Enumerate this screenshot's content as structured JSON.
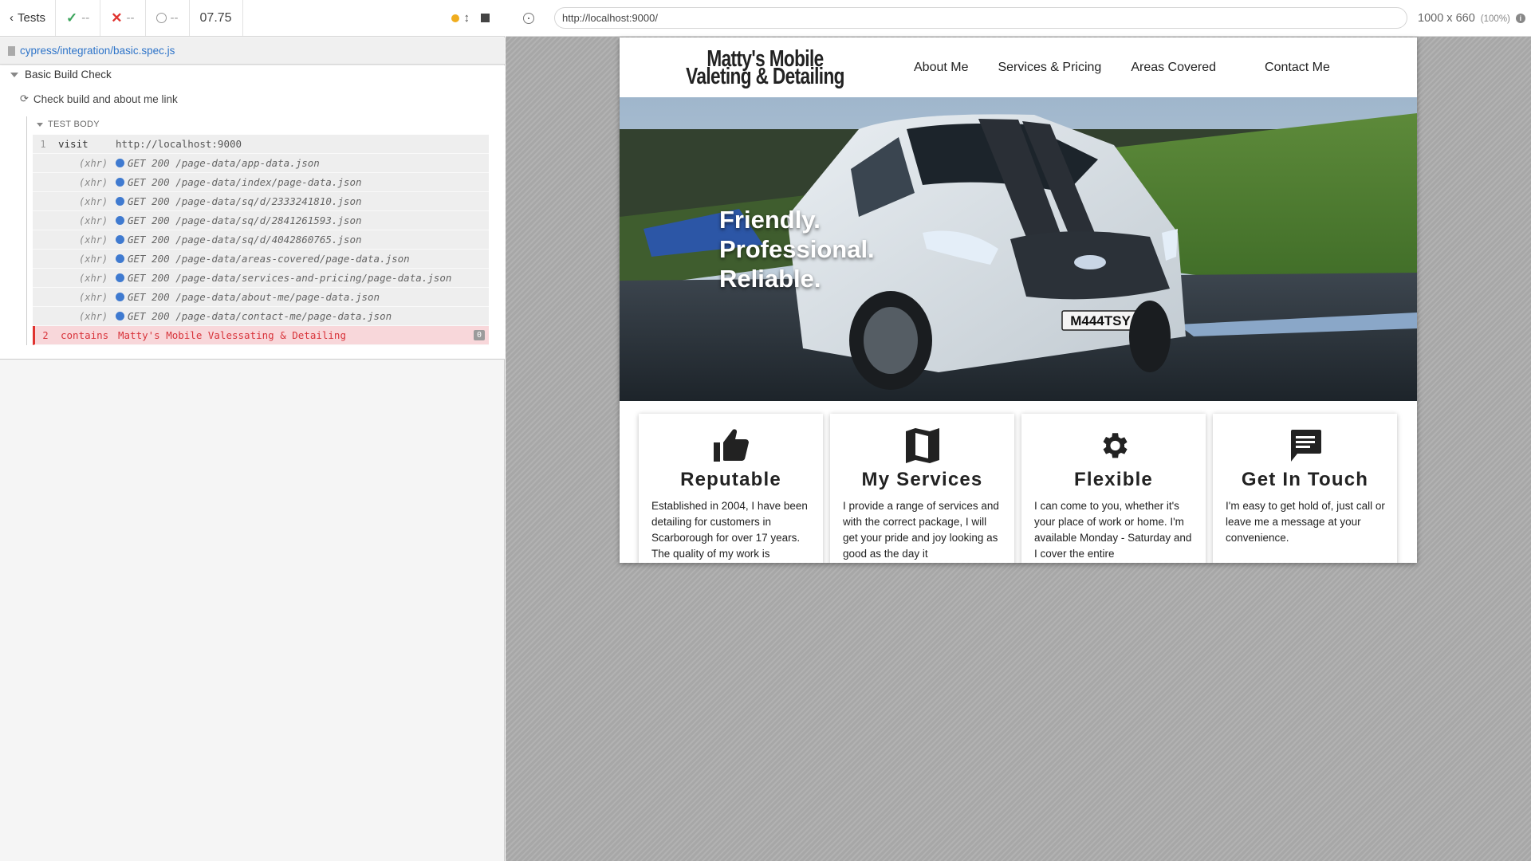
{
  "reporter": {
    "tests_label": "Tests",
    "passed": "--",
    "failed": "--",
    "pending": "--",
    "duration": "07.75",
    "spec_file": "cypress/integration/basic.spec.js",
    "suite_title": "Basic Build Check",
    "test_title": "Check build and about me link",
    "test_body_label": "TEST BODY",
    "commands": [
      {
        "num": "1",
        "name": "visit",
        "message": "http://localhost:9000",
        "type": "command"
      },
      {
        "num": "",
        "name": "(xhr)",
        "message": "GET 200 /page-data/app-data.json",
        "type": "xhr"
      },
      {
        "num": "",
        "name": "(xhr)",
        "message": "GET 200 /page-data/index/page-data.json",
        "type": "xhr"
      },
      {
        "num": "",
        "name": "(xhr)",
        "message": "GET 200 /page-data/sq/d/2333241810.json",
        "type": "xhr"
      },
      {
        "num": "",
        "name": "(xhr)",
        "message": "GET 200 /page-data/sq/d/2841261593.json",
        "type": "xhr"
      },
      {
        "num": "",
        "name": "(xhr)",
        "message": "GET 200 /page-data/sq/d/4042860765.json",
        "type": "xhr"
      },
      {
        "num": "",
        "name": "(xhr)",
        "message": "GET 200 /page-data/areas-covered/page-data.json",
        "type": "xhr"
      },
      {
        "num": "",
        "name": "(xhr)",
        "message": "GET 200 /page-data/services-and-pricing/page-data.json",
        "type": "xhr"
      },
      {
        "num": "",
        "name": "(xhr)",
        "message": "GET 200 /page-data/about-me/page-data.json",
        "type": "xhr"
      },
      {
        "num": "",
        "name": "(xhr)",
        "message": "GET 200 /page-data/contact-me/page-data.json",
        "type": "xhr"
      },
      {
        "num": "2",
        "name": "contains",
        "message": "Matty's Mobile Valessating & Detailing",
        "type": "failed",
        "badge": "0"
      }
    ]
  },
  "aut": {
    "url": "http://localhost:9000/",
    "viewport": "1000 x 660",
    "viewport_pct": "(100%)"
  },
  "site": {
    "logo": "Matty's Mobile Valeting & Detailing",
    "nav": [
      "About Me",
      "Services & Pricing",
      "Areas Covered",
      "Contact Me"
    ],
    "hero_lines": [
      "Friendly.",
      "Professional.",
      "Reliable."
    ],
    "van_plate": "M444TSY",
    "cards": [
      {
        "icon": "thumbs-up-icon",
        "title": "Reputable",
        "text": "Established in 2004, I have been detailing for customers in Scarborough for over 17 years. The quality of my work is"
      },
      {
        "icon": "map-icon",
        "title": "My Services",
        "text": "I provide a range of services and with the correct package, I will get your pride and joy looking as good as the day it"
      },
      {
        "icon": "gear-icon",
        "title": "Flexible",
        "text": "I can come to you, whether it's your place of work or home. I'm available Monday - Saturday and I cover the entire"
      },
      {
        "icon": "chat-icon",
        "title": "Get In Touch",
        "text": "I'm easy to get hold of, just call or leave me a message at your convenience."
      }
    ]
  },
  "colors": {
    "pass": "#3ba55c",
    "fail": "#e0332f",
    "link": "#2e74c9",
    "xhr_dot": "#3f7ad0"
  }
}
